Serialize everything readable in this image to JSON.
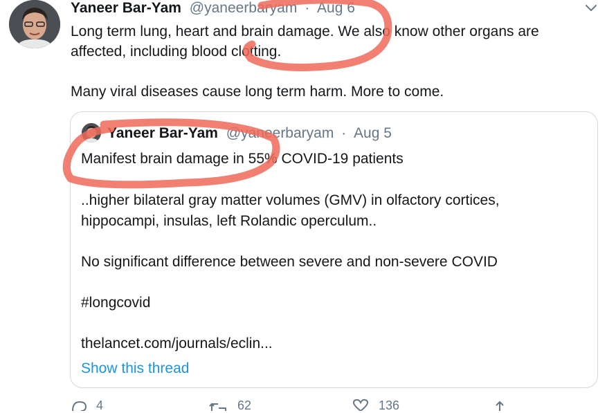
{
  "tweet": {
    "author_name": "Yaneer Bar-Yam",
    "author_handle": "@yaneerbaryam",
    "separator": "·",
    "date": "Aug 6",
    "paragraph1": "Long term lung, heart and brain damage. We also know other organs are affected, including blood clotting.",
    "paragraph2": "Many viral diseases cause long term harm. More to come."
  },
  "quoted_tweet": {
    "author_name": "Yaneer Bar-Yam",
    "author_handle": "@yaneerbaryam",
    "separator": "·",
    "date": "Aug 5",
    "line1": "Manifest brain damage in 55% COVID-19 patients",
    "line2": "..higher bilateral gray matter volumes (GMV) in olfactory cortices,",
    "line3": "hippocampi, insulas, left Rolandic operculum..",
    "line4": "No significant difference between severe and non-severe COVID",
    "line5": "#longcovid",
    "line6": "thelancet.com/journals/eclin...",
    "show_thread": "Show this thread"
  },
  "actions": {
    "reply_count": "4",
    "retweet_count": "62",
    "like_count": "136"
  },
  "icons": {
    "menu": "chevron-down-icon",
    "reply": "reply-icon",
    "retweet": "retweet-icon",
    "like": "heart-icon",
    "share": "share-icon"
  },
  "colors": {
    "muted": "#657786",
    "link": "#1b95e0",
    "border": "#cfd9de",
    "annotation": "#ee6a5a"
  }
}
